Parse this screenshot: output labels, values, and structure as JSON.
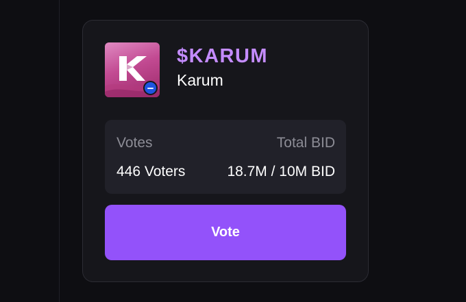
{
  "token": {
    "ticker": "$KARUM",
    "name": "Karum",
    "logo_icon": "karum-logo-icon",
    "chain_icon": "chain-badge-icon"
  },
  "stats": {
    "votes_label": "Votes",
    "votes_value": "446 Voters",
    "total_bid_label": "Total BID",
    "total_bid_value": "18.7M / 10M BID"
  },
  "actions": {
    "vote_label": "Vote"
  },
  "colors": {
    "background": "#0e0e12",
    "card": "#16161b",
    "accent": "#9352fa",
    "ticker": "#c48cff",
    "muted_text": "#8d8d96"
  }
}
